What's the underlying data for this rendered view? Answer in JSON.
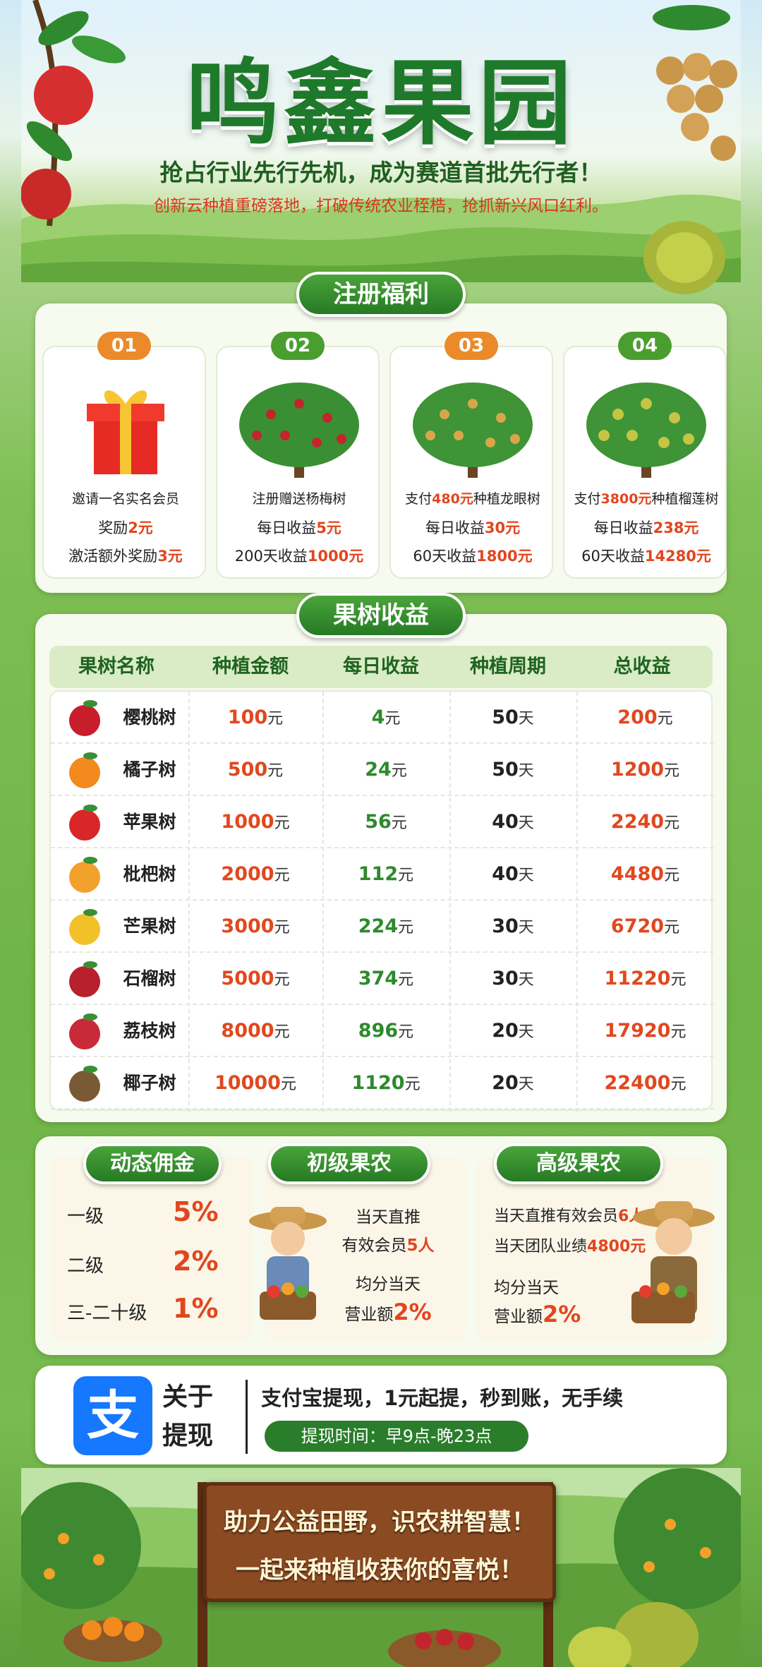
{
  "header": {
    "title": "鸣鑫果园",
    "subtitle": "抢占行业先行先机，成为赛道首批先行者！",
    "tagline": "创新云种植重磅落地，打破传统农业桎梏，抢抓新兴风口红利。"
  },
  "welfare": {
    "title": "注册福利",
    "cards": [
      {
        "num": "01",
        "line1": "邀请一名实名会员",
        "line2a": "奖励",
        "line2b": "2元",
        "line3a": "激活额外奖励",
        "line3b": "3元"
      },
      {
        "num": "02",
        "line1": "注册赠送杨梅树",
        "line2a": "每日收益",
        "line2b": "5元",
        "line3a": "200天收益",
        "line3b": "1000元"
      },
      {
        "num": "03",
        "line1a": "支付",
        "line1b": "480元",
        "line1c": "种植龙眼树",
        "line2a": "每日收益",
        "line2b": "30元",
        "line3a": "60天收益",
        "line3b": "1800元"
      },
      {
        "num": "04",
        "line1a": "支付",
        "line1b": "3800元",
        "line1c": "种植榴莲树",
        "line2a": "每日收益",
        "line2b": "238元",
        "line3a": "60天收益",
        "line3b": "14280元"
      }
    ]
  },
  "income": {
    "title": "果树收益",
    "headers": [
      "果树名称",
      "种植金额",
      "每日收益",
      "种植周期",
      "总收益"
    ],
    "unit_yuan": "元",
    "unit_day": "天",
    "rows": [
      {
        "name": "樱桃树",
        "invest": "100",
        "daily": "4",
        "cycle": "50",
        "total": "200"
      },
      {
        "name": "橘子树",
        "invest": "500",
        "daily": "24",
        "cycle": "50",
        "total": "1200"
      },
      {
        "name": "苹果树",
        "invest": "1000",
        "daily": "56",
        "cycle": "40",
        "total": "2240"
      },
      {
        "name": "枇杷树",
        "invest": "2000",
        "daily": "112",
        "cycle": "40",
        "total": "4480"
      },
      {
        "name": "芒果树",
        "invest": "3000",
        "daily": "224",
        "cycle": "30",
        "total": "6720"
      },
      {
        "name": "石榴树",
        "invest": "5000",
        "daily": "374",
        "cycle": "30",
        "total": "11220"
      },
      {
        "name": "荔枝树",
        "invest": "8000",
        "daily": "896",
        "cycle": "20",
        "total": "17920"
      },
      {
        "name": "椰子树",
        "invest": "10000",
        "daily": "1120",
        "cycle": "20",
        "total": "22400"
      }
    ]
  },
  "commission": {
    "title": "动态佣金",
    "levels": [
      {
        "label": "一级",
        "value": "5%"
      },
      {
        "label": "二级",
        "value": "2%"
      },
      {
        "label": "三-二十级",
        "value": "1%"
      }
    ]
  },
  "junior": {
    "title": "初级果农",
    "line1": "当天直推",
    "line2a": "有效会员",
    "line2b": "5人",
    "line3": "均分当天",
    "line4a": "营业额",
    "line4b": "2%"
  },
  "senior": {
    "title": "高级果农",
    "line1a": "当天直推有效会员",
    "line1b": "6人",
    "line2a": "当天团队业绩",
    "line2b": "4800元",
    "line3": "均分当天",
    "line4a": "营业额",
    "line4b": "2%"
  },
  "withdraw": {
    "icon_char": "支",
    "label1": "关于",
    "label2": "提现",
    "desc": "支付宝提现，1元起提，秒到账，无手续",
    "time": "提现时间：早9点-晚23点"
  },
  "footer": {
    "line1": "助力公益田野，识农耕智慧！",
    "line2": "一起来种植收获你的喜悦！"
  },
  "colors": {
    "brand_green": "#1e7a2a",
    "accent_red": "#e2461f",
    "pill_green": "#267a24",
    "alipay_blue": "#1677ff"
  }
}
